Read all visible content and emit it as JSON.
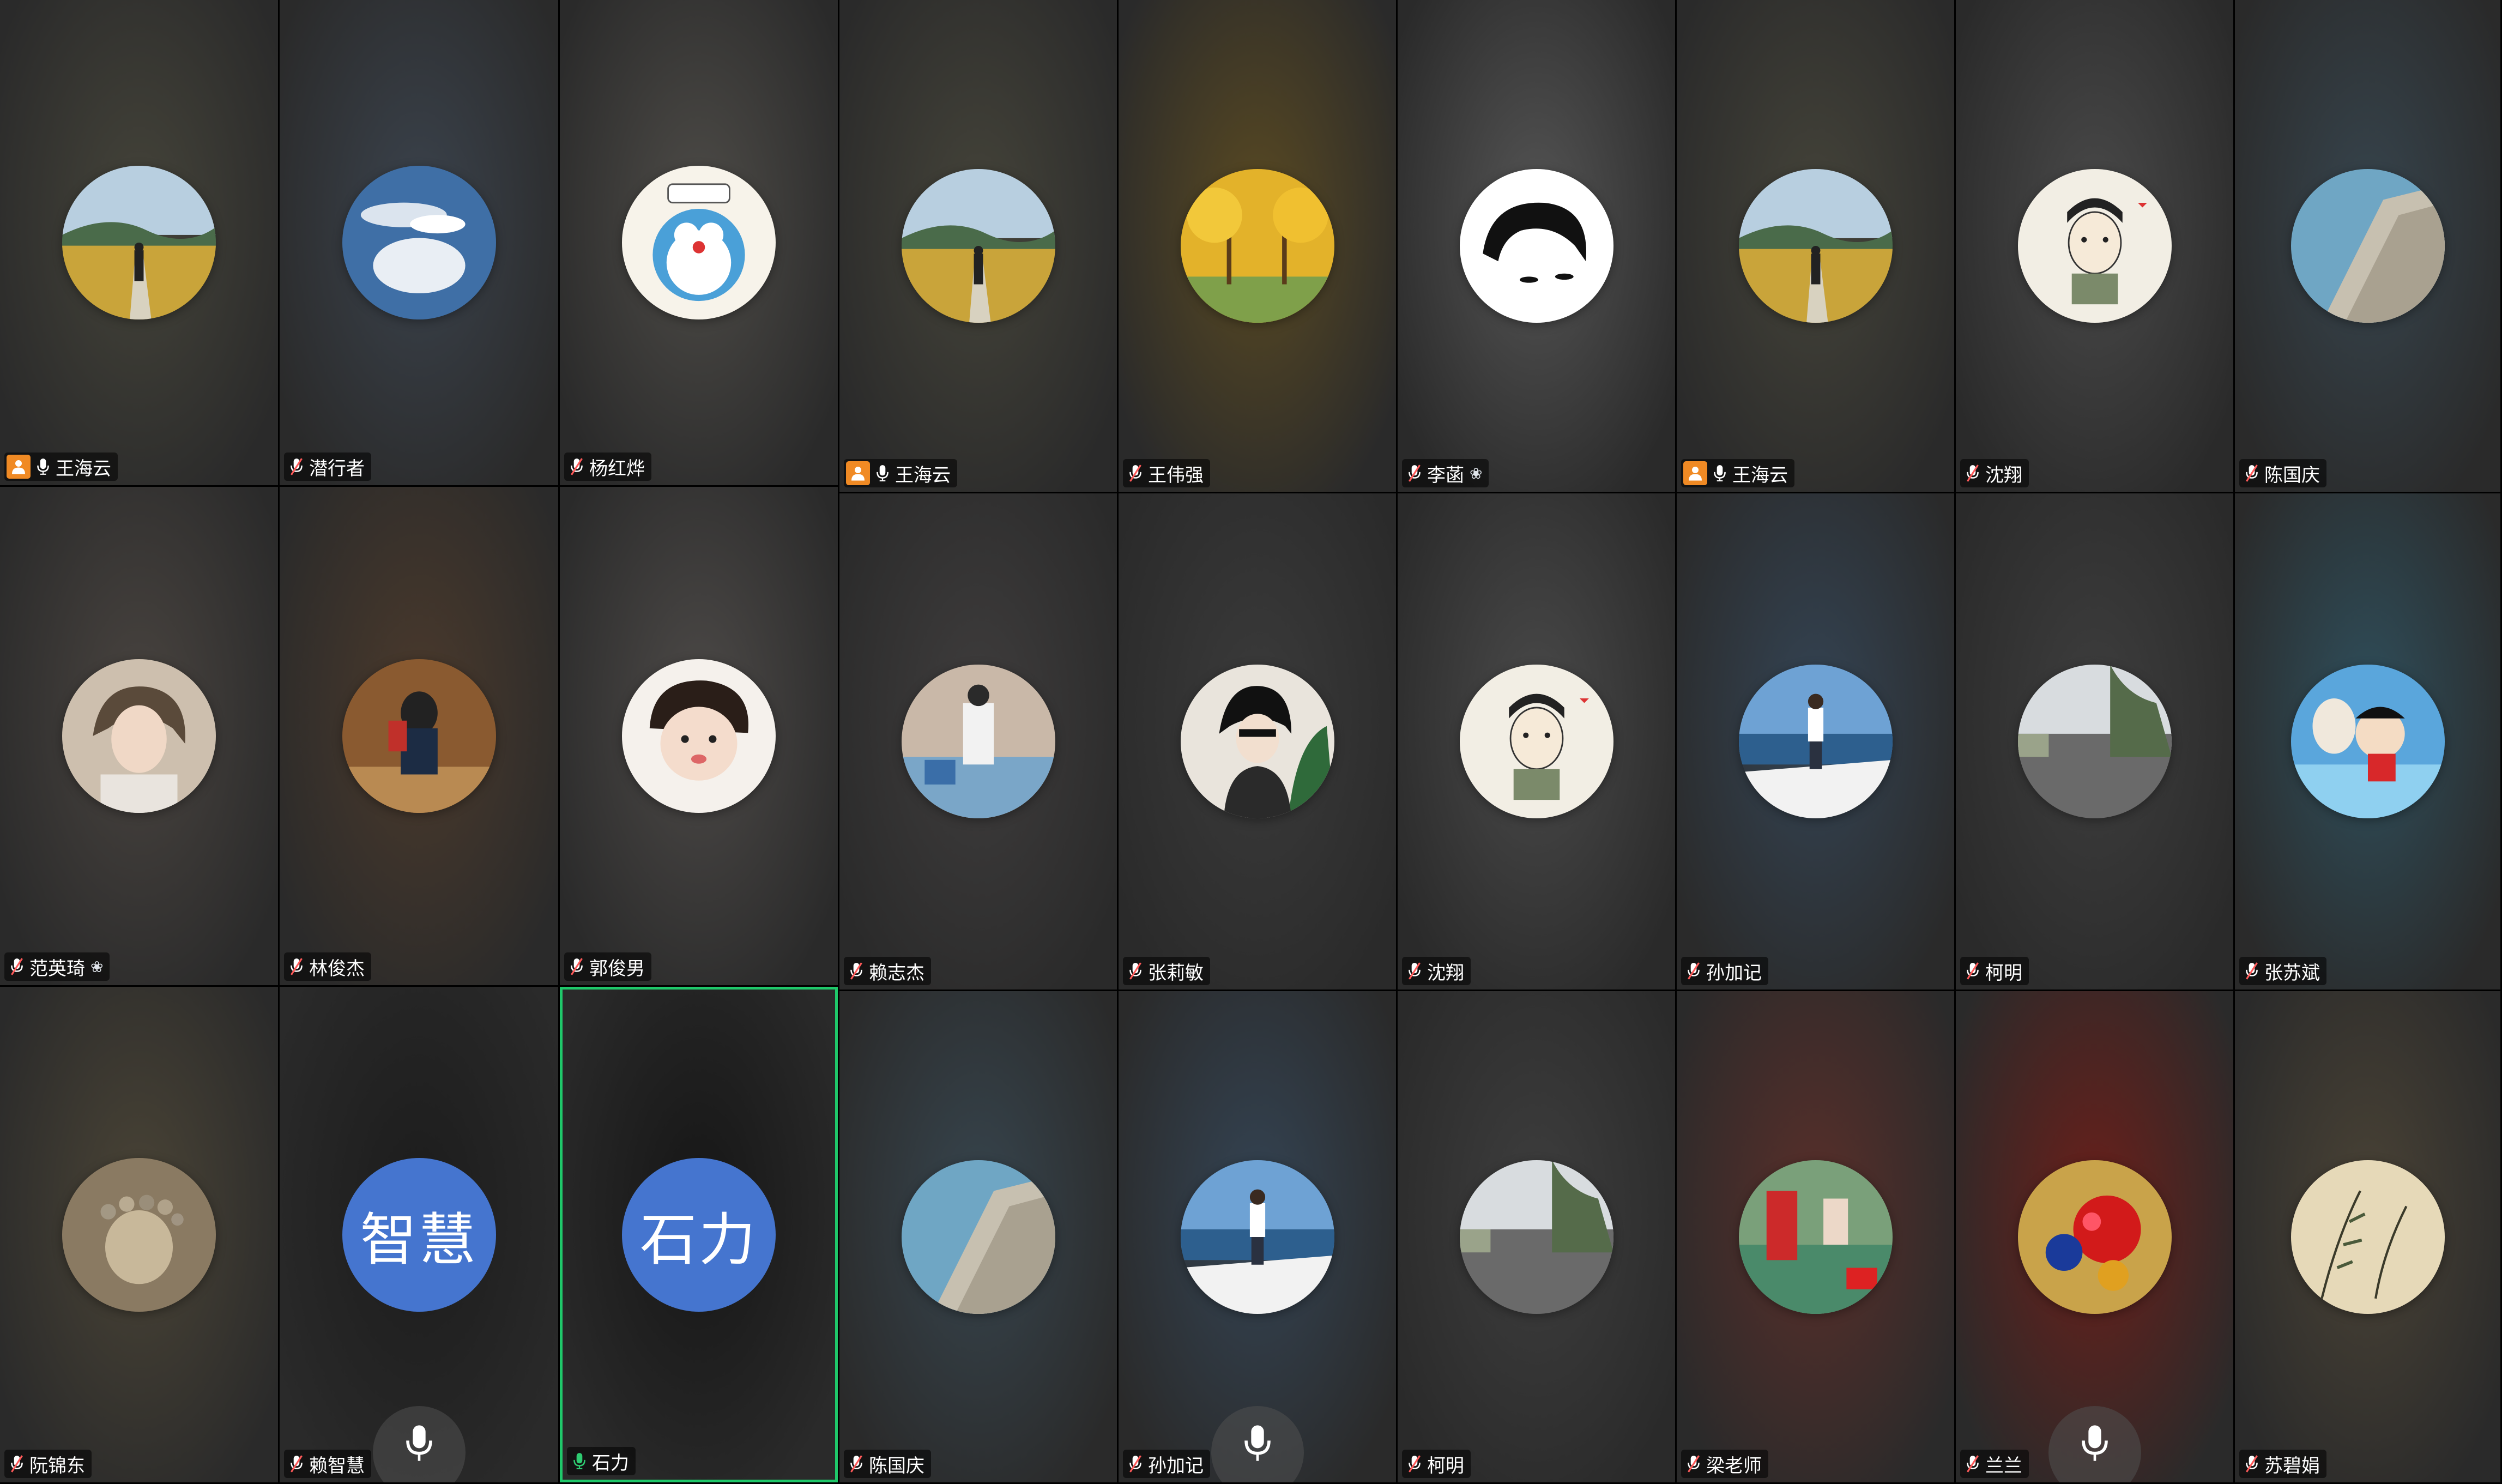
{
  "participants": [
    {
      "name": "王海云",
      "host": true,
      "mic": "on",
      "avatar": "road",
      "bg": "#45443a"
    },
    {
      "name": "潜行者",
      "host": false,
      "mic": "muted",
      "avatar": "sky",
      "bg": "#3b434d"
    },
    {
      "name": "杨红烨",
      "host": false,
      "mic": "muted",
      "avatar": "cartoon",
      "bg": "#4e4c48"
    },
    {
      "name": "王海云",
      "host": true,
      "mic": "on",
      "avatar": "road",
      "bg": "#45443a"
    },
    {
      "name": "王伟强",
      "host": false,
      "mic": "muted",
      "avatar": "ginkgo",
      "bg": "#5a4a22"
    },
    {
      "name": "李菡",
      "host": false,
      "mic": "muted",
      "avatar": "sketch",
      "bg": "#555555",
      "symbol": "❀"
    },
    {
      "name": "王海云",
      "host": true,
      "mic": "on",
      "avatar": "road",
      "bg": "#45443a"
    },
    {
      "name": "沈翔",
      "host": false,
      "mic": "muted",
      "avatar": "drawing",
      "bg": "#4a4a4a"
    },
    {
      "name": "陈国庆",
      "host": false,
      "mic": "muted",
      "avatar": "coast",
      "bg": "#37454e"
    },
    {
      "name": "范英琦",
      "host": false,
      "mic": "muted",
      "avatar": "woman",
      "bg": "#494440",
      "symbol": "❀"
    },
    {
      "name": "林俊杰",
      "host": false,
      "mic": "muted",
      "avatar": "kid",
      "bg": "#4b3a2c"
    },
    {
      "name": "郭俊男",
      "host": false,
      "mic": "muted",
      "avatar": "baby",
      "bg": "#4d4a48"
    },
    {
      "name": "赖志杰",
      "host": false,
      "mic": "muted",
      "avatar": "shop",
      "bg": "#3f3d3d"
    },
    {
      "name": "张莉敏",
      "host": false,
      "mic": "muted",
      "avatar": "girl",
      "bg": "#3b3b3b"
    },
    {
      "name": "沈翔",
      "host": false,
      "mic": "muted",
      "avatar": "drawing",
      "bg": "#4a4a4a"
    },
    {
      "name": "孙加记",
      "host": false,
      "mic": "muted",
      "avatar": "boat",
      "bg": "#344454"
    },
    {
      "name": "柯明",
      "host": false,
      "mic": "muted",
      "avatar": "street",
      "bg": "#3e3e3e"
    },
    {
      "name": "张苏斌",
      "host": false,
      "mic": "muted",
      "avatar": "shinchan",
      "bg": "#2f4f5c"
    },
    {
      "name": "阮锦东",
      "host": false,
      "mic": "muted",
      "avatar": "stones",
      "bg": "#4a4436"
    },
    {
      "name": "赖智慧",
      "host": false,
      "mic": "muted",
      "avatar": "text",
      "initials": "智慧",
      "bg": "#1c1c1c",
      "bigmic": true
    },
    {
      "name": "石力",
      "host": false,
      "mic": "on",
      "avatar": "text",
      "initials": "石力",
      "bg": "#161616",
      "active": true
    },
    {
      "name": "陈国庆",
      "host": false,
      "mic": "muted",
      "avatar": "coast",
      "bg": "#37454e"
    },
    {
      "name": "孙加记",
      "host": false,
      "mic": "muted",
      "avatar": "boat",
      "bg": "#344454",
      "bigmic": true
    },
    {
      "name": "柯明",
      "host": false,
      "mic": "muted",
      "avatar": "street",
      "bg": "#3e3e3e"
    },
    {
      "name": "梁老师",
      "host": false,
      "mic": "muted",
      "avatar": "court",
      "bg": "#5a2f2a"
    },
    {
      "name": "兰兰",
      "host": false,
      "mic": "muted",
      "avatar": "beads",
      "bg": "#6b1f1a",
      "bigmic": true
    },
    {
      "name": "苏碧娟",
      "host": false,
      "mic": "muted",
      "avatar": "painting",
      "bg": "#4a4336"
    }
  ],
  "colors": {
    "active_border": "#1fc86a",
    "text_avatar": "#4575cf",
    "host_badge": "#f08a24",
    "mic_on": "#ffffff",
    "mic_active": "#2ecc71",
    "mute": "#ff5a5a"
  }
}
